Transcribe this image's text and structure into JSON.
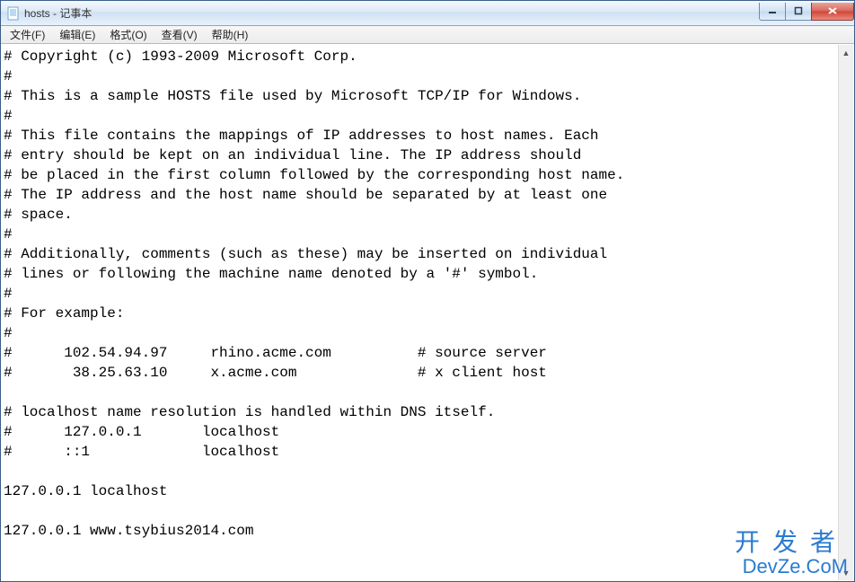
{
  "window": {
    "title": "hosts - 记事本"
  },
  "menu": {
    "file": "文件(F)",
    "edit": "编辑(E)",
    "format": "格式(O)",
    "view": "查看(V)",
    "help": "帮助(H)"
  },
  "editor": {
    "text": "# Copyright (c) 1993-2009 Microsoft Corp.\n#\n# This is a sample HOSTS file used by Microsoft TCP/IP for Windows.\n#\n# This file contains the mappings of IP addresses to host names. Each\n# entry should be kept on an individual line. The IP address should\n# be placed in the first column followed by the corresponding host name.\n# The IP address and the host name should be separated by at least one\n# space.\n#\n# Additionally, comments (such as these) may be inserted on individual\n# lines or following the machine name denoted by a '#' symbol.\n#\n# For example:\n#\n#      102.54.94.97     rhino.acme.com          # source server\n#       38.25.63.10     x.acme.com              # x client host\n\n# localhost name resolution is handled within DNS itself.\n#      127.0.0.1       localhost\n#      ::1             localhost\n\n127.0.0.1 localhost\n\n127.0.0.1 www.tsybius2014.com"
  },
  "watermark": {
    "line1": "开发者",
    "line2": "DevZe.CoM"
  }
}
